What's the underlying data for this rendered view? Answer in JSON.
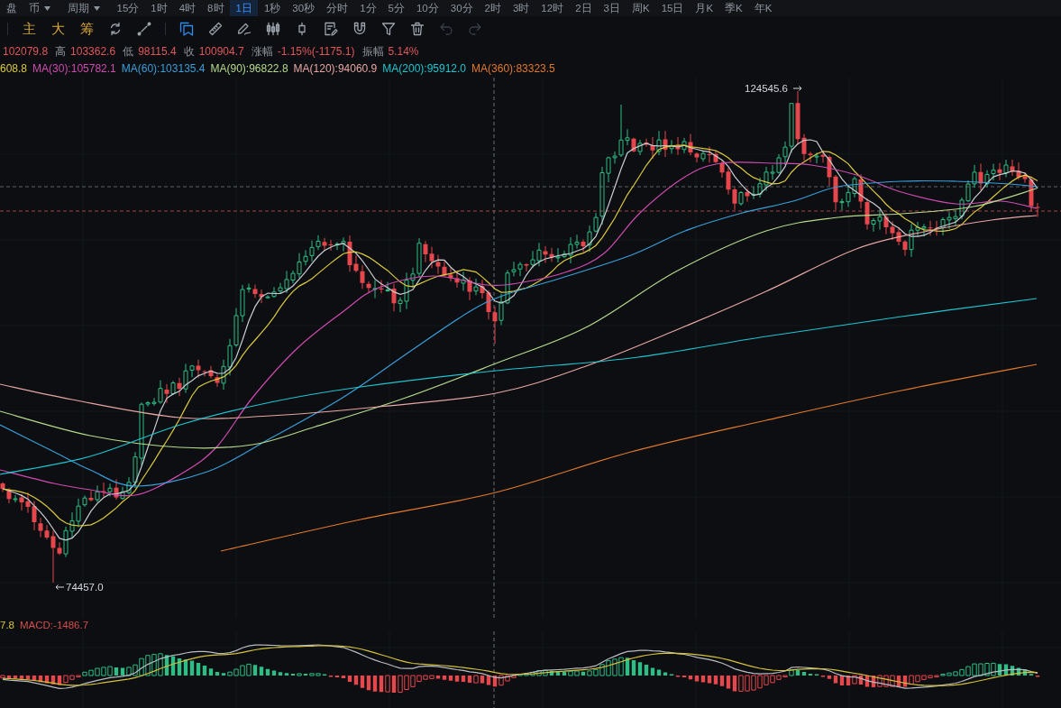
{
  "top_bar": [
    {
      "label": "盘",
      "dropdown": false,
      "selected": false
    },
    {
      "label": "币",
      "dropdown": true,
      "selected": false
    },
    {
      "label": "周期",
      "dropdown": true,
      "selected": false
    },
    {
      "label": "15分",
      "dropdown": false,
      "selected": false
    },
    {
      "label": "1时",
      "dropdown": false,
      "selected": false
    },
    {
      "label": "4时",
      "dropdown": false,
      "selected": false
    },
    {
      "label": "8时",
      "dropdown": false,
      "selected": false
    },
    {
      "label": "1日",
      "dropdown": false,
      "selected": true
    },
    {
      "label": "1秒",
      "dropdown": false,
      "selected": false
    },
    {
      "label": "30秒",
      "dropdown": false,
      "selected": false
    },
    {
      "label": "分时",
      "dropdown": false,
      "selected": false
    },
    {
      "label": "1分",
      "dropdown": false,
      "selected": false
    },
    {
      "label": "5分",
      "dropdown": false,
      "selected": false
    },
    {
      "label": "10分",
      "dropdown": false,
      "selected": false
    },
    {
      "label": "30分",
      "dropdown": false,
      "selected": false
    },
    {
      "label": "2时",
      "dropdown": false,
      "selected": false
    },
    {
      "label": "3时",
      "dropdown": false,
      "selected": false
    },
    {
      "label": "12时",
      "dropdown": false,
      "selected": false
    },
    {
      "label": "2日",
      "dropdown": false,
      "selected": false
    },
    {
      "label": "3日",
      "dropdown": false,
      "selected": false
    },
    {
      "label": "周K",
      "dropdown": false,
      "selected": false
    },
    {
      "label": "15日",
      "dropdown": false,
      "selected": false
    },
    {
      "label": "月K",
      "dropdown": false,
      "selected": false
    },
    {
      "label": "季K",
      "dropdown": false,
      "selected": false
    },
    {
      "label": "年K",
      "dropdown": false,
      "selected": false
    }
  ],
  "toolbar": {
    "indicators": [
      {
        "label": "主"
      },
      {
        "label": "大"
      },
      {
        "label": "筹"
      }
    ],
    "chart_tools": [
      {
        "kind": "refresh",
        "selected": false,
        "disabled": false
      },
      {
        "kind": "line",
        "selected": false,
        "disabled": false
      }
    ],
    "drawing_tools": [
      {
        "kind": "bookmark",
        "selected": true,
        "disabled": false
      },
      {
        "kind": "ruler",
        "selected": false,
        "disabled": false
      },
      {
        "kind": "pen",
        "selected": false,
        "disabled": false
      },
      {
        "kind": "candles",
        "selected": false,
        "disabled": false
      },
      {
        "kind": "candle",
        "selected": false,
        "disabled": false
      },
      {
        "kind": "note",
        "selected": false,
        "disabled": false
      },
      {
        "kind": "magnet",
        "selected": false,
        "disabled": false
      },
      {
        "kind": "filter",
        "selected": false,
        "disabled": false
      },
      {
        "kind": "trash",
        "selected": false,
        "disabled": false
      },
      {
        "kind": "undo",
        "selected": false,
        "disabled": true
      },
      {
        "kind": "redo",
        "selected": false,
        "disabled": true
      }
    ]
  },
  "quote": [
    {
      "value": "102079.8"
    },
    {
      "label": "高",
      "value": "103362.6"
    },
    {
      "label": "低",
      "value": "98115.4"
    },
    {
      "label": "收",
      "value": "100904.7"
    },
    {
      "label": "涨幅",
      "value": "-1.15%(-1175.1)"
    },
    {
      "label": "振幅",
      "value": "5.14%"
    }
  ],
  "moving_averages": [
    {
      "text": "608.8",
      "color": "#dccb3f"
    },
    {
      "text": "MA(30):105782.1",
      "color": "#d04bb0"
    },
    {
      "text": "MA(60):103135.4",
      "color": "#3a9ed8"
    },
    {
      "text": "MA(90):96822.8",
      "color": "#b6d98c"
    },
    {
      "text": "MA(120):94060.9",
      "color": "#e6a6a3"
    },
    {
      "text": "MA(200):95912.0",
      "color": "#1fc5d0"
    },
    {
      "text": "MA(360):83323.5",
      "color": "#e2792c"
    }
  ],
  "chart": {
    "high_marker": "124545.6",
    "low_marker": "74457.0"
  },
  "macd": {
    "legend": [
      {
        "text": "7.8",
        "color": "#d8c63e"
      },
      {
        "text": "MACD:-1486.7",
        "color": "#d24d4b"
      }
    ]
  }
}
